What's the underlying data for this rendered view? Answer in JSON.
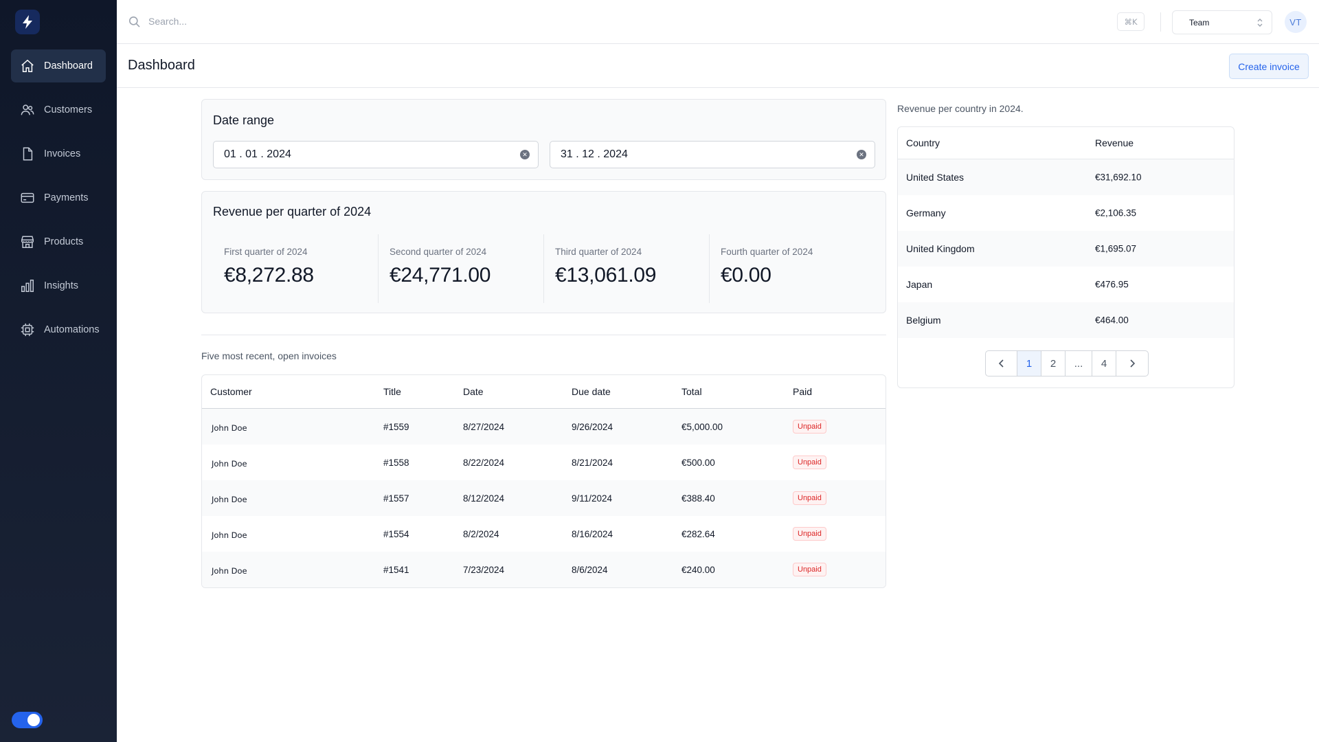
{
  "search": {
    "placeholder": "Search...",
    "shortcut": "⌘K"
  },
  "team_select": {
    "value": "Team"
  },
  "avatar": {
    "initials": "VT"
  },
  "sidebar": {
    "items": [
      {
        "label": "Dashboard",
        "icon": "home-icon",
        "active": true
      },
      {
        "label": "Customers",
        "icon": "users-icon"
      },
      {
        "label": "Invoices",
        "icon": "document-icon"
      },
      {
        "label": "Payments",
        "icon": "credit-card-icon"
      },
      {
        "label": "Products",
        "icon": "store-icon"
      },
      {
        "label": "Insights",
        "icon": "bar-chart-icon"
      },
      {
        "label": "Automations",
        "icon": "chip-icon"
      }
    ]
  },
  "page": {
    "title": "Dashboard",
    "create_label": "Create invoice"
  },
  "date_range": {
    "title": "Date range",
    "start": "01 . 01 . 2024",
    "end": "31 . 12 . 2024"
  },
  "quarters": {
    "title": "Revenue per quarter of 2024",
    "items": [
      {
        "label": "First quarter of 2024",
        "value": "€8,272.88"
      },
      {
        "label": "Second quarter of 2024",
        "value": "€24,771.00"
      },
      {
        "label": "Third quarter of 2024",
        "value": "€13,061.09"
      },
      {
        "label": "Fourth quarter of 2024",
        "value": "€0.00"
      }
    ]
  },
  "invoices": {
    "caption": "Five most recent, open invoices",
    "headers": {
      "customer": "Customer",
      "title": "Title",
      "date": "Date",
      "due": "Due date",
      "total": "Total",
      "paid": "Paid"
    },
    "rows": [
      {
        "customer": "John Doe",
        "title": "#1559",
        "date": "8/27/2024",
        "due": "9/26/2024",
        "total": "€5,000.00",
        "paid": "Unpaid"
      },
      {
        "customer": "John Doe",
        "title": "#1558",
        "date": "8/22/2024",
        "due": "8/21/2024",
        "total": "€500.00",
        "paid": "Unpaid"
      },
      {
        "customer": "John Doe",
        "title": "#1557",
        "date": "8/12/2024",
        "due": "9/11/2024",
        "total": "€388.40",
        "paid": "Unpaid"
      },
      {
        "customer": "John Doe",
        "title": "#1554",
        "date": "8/2/2024",
        "due": "8/16/2024",
        "total": "€282.64",
        "paid": "Unpaid"
      },
      {
        "customer": "John Doe",
        "title": "#1541",
        "date": "7/23/2024",
        "due": "8/6/2024",
        "total": "€240.00",
        "paid": "Unpaid"
      }
    ]
  },
  "countries": {
    "caption": "Revenue per country in 2024.",
    "headers": {
      "country": "Country",
      "revenue": "Revenue"
    },
    "rows": [
      {
        "country": "United States",
        "revenue": "€31,692.10"
      },
      {
        "country": "Germany",
        "revenue": "€2,106.35"
      },
      {
        "country": "United Kingdom",
        "revenue": "€1,695.07"
      },
      {
        "country": "Japan",
        "revenue": "€476.95"
      },
      {
        "country": "Belgium",
        "revenue": "€464.00"
      }
    ],
    "pagination": {
      "pages": [
        "1",
        "2",
        "...",
        "4"
      ],
      "current": "1"
    }
  },
  "colors": {
    "accent": "#2563eb",
    "sidebar": "#0f1729",
    "unpaid": "#dc2626"
  }
}
